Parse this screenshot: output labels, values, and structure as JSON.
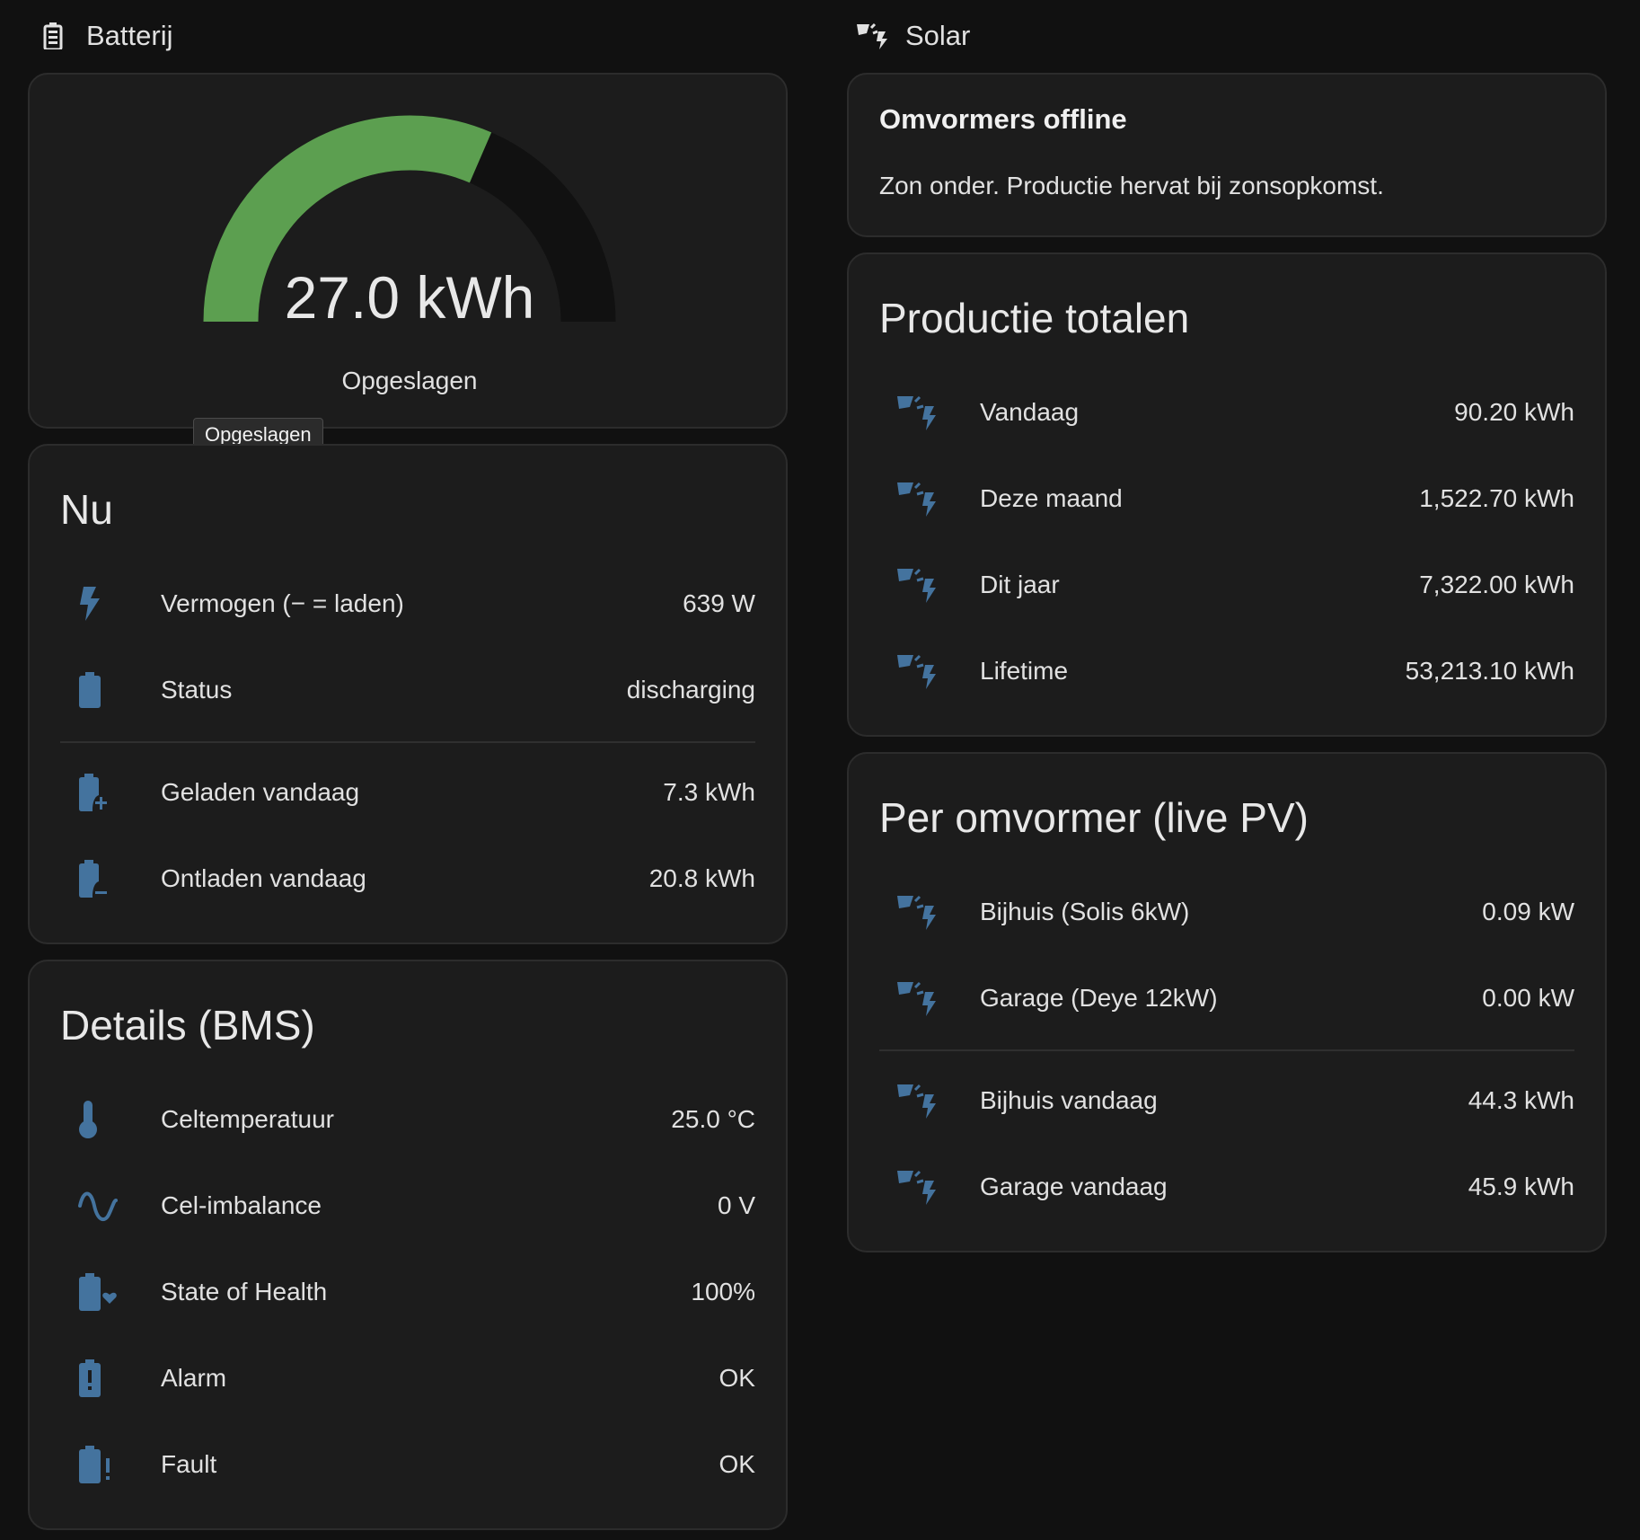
{
  "left": {
    "header": {
      "title": "Batterij",
      "icon": "battery-icon"
    },
    "gauge": {
      "value_text": "27.0 kWh",
      "label": "Opgeslagen",
      "tooltip": "Opgeslagen",
      "fill_fraction": 0.63,
      "fill_color": "#5c9f50",
      "track_color": "#111111"
    },
    "nu": {
      "title": "Nu",
      "rows": [
        {
          "label": "Vermogen (− = laden)",
          "value": "639 W",
          "icon": "flash-icon"
        },
        {
          "label": "Status",
          "value": "discharging",
          "icon": "battery-icon"
        },
        {
          "label": "Geladen vandaag",
          "value": "7.3 kWh",
          "icon": "battery-plus-icon"
        },
        {
          "label": "Ontladen vandaag",
          "value": "20.8 kWh",
          "icon": "battery-minus-icon"
        }
      ]
    },
    "details": {
      "title": "Details (BMS)",
      "rows": [
        {
          "label": "Celtemperatuur",
          "value": "25.0 °C",
          "icon": "thermometer-icon"
        },
        {
          "label": "Cel-imbalance",
          "value": "0 V",
          "icon": "sine-wave-icon"
        },
        {
          "label": "State of Health",
          "value": "100%",
          "icon": "battery-heart-icon"
        },
        {
          "label": "Alarm",
          "value": "OK",
          "icon": "battery-alert-icon"
        },
        {
          "label": "Fault",
          "value": "OK",
          "icon": "battery-exclamation-icon"
        }
      ]
    }
  },
  "right": {
    "header": {
      "title": "Solar",
      "icon": "solar-power-icon"
    },
    "alert": {
      "title": "Omvormers offline",
      "text": "Zon onder. Productie hervat bij zonsopkomst."
    },
    "totals": {
      "title": "Productie totalen",
      "rows": [
        {
          "label": "Vandaag",
          "value": "90.20 kWh",
          "icon": "solar-power-icon"
        },
        {
          "label": "Deze maand",
          "value": "1,522.70 kWh",
          "icon": "solar-power-icon"
        },
        {
          "label": "Dit jaar",
          "value": "7,322.00 kWh",
          "icon": "solar-power-icon"
        },
        {
          "label": "Lifetime",
          "value": "53,213.10 kWh",
          "icon": "solar-power-icon"
        }
      ]
    },
    "per_inverter": {
      "title": "Per omvormer (live PV)",
      "rows": [
        {
          "label": "Bijhuis (Solis 6kW)",
          "value": "0.09 kW",
          "icon": "solar-power-icon"
        },
        {
          "label": "Garage (Deye 12kW)",
          "value": "0.00 kW",
          "icon": "solar-power-icon"
        },
        {
          "label": "Bijhuis vandaag",
          "value": "44.3 kWh",
          "icon": "solar-power-icon"
        },
        {
          "label": "Garage vandaag",
          "value": "45.9 kWh",
          "icon": "solar-power-icon"
        }
      ]
    }
  },
  "colors": {
    "icon": "#44739e",
    "background": "#111111",
    "card": "#1c1c1c"
  }
}
